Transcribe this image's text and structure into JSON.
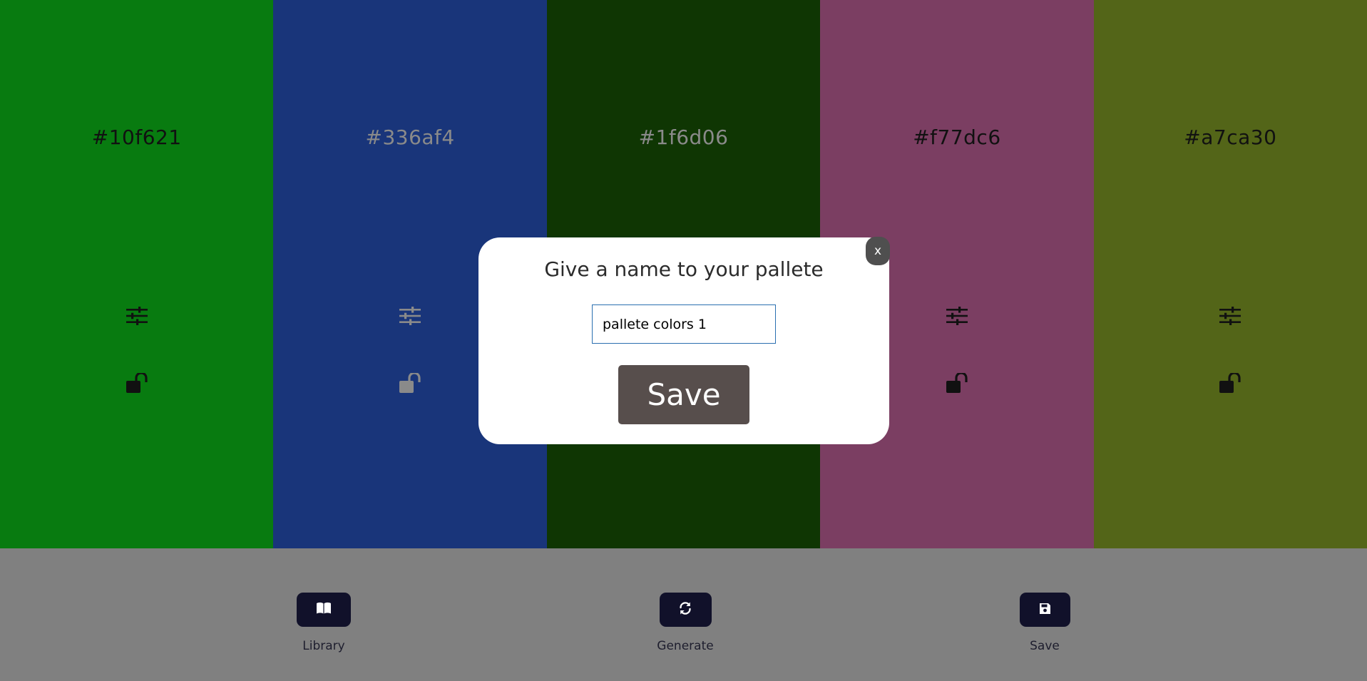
{
  "palette": [
    {
      "hex": "#10f621",
      "bg": "#087b10",
      "fg": "#111111"
    },
    {
      "hex": "#336af4",
      "bg": "#19357a",
      "fg": "#8a8a8a"
    },
    {
      "hex": "#1f6d06",
      "bg": "#0f3603",
      "fg": "#8a8a8a"
    },
    {
      "hex": "#f77dc6",
      "bg": "#7b3e62",
      "fg": "#111111"
    },
    {
      "hex": "#a7ca30",
      "bg": "#536518",
      "fg": "#111111"
    }
  ],
  "panel": {
    "library_label": "Library",
    "generate_label": "Generate",
    "save_label": "Save"
  },
  "modal": {
    "title": "Give a name to your pallete",
    "close_label": "x",
    "input_value": "pallete colors 1",
    "save_button_label": "Save"
  },
  "icons": {
    "adjust": "sliders-icon",
    "lock": "unlock-icon",
    "library": "book-icon",
    "generate": "refresh-icon",
    "save": "floppy-disk-icon"
  }
}
